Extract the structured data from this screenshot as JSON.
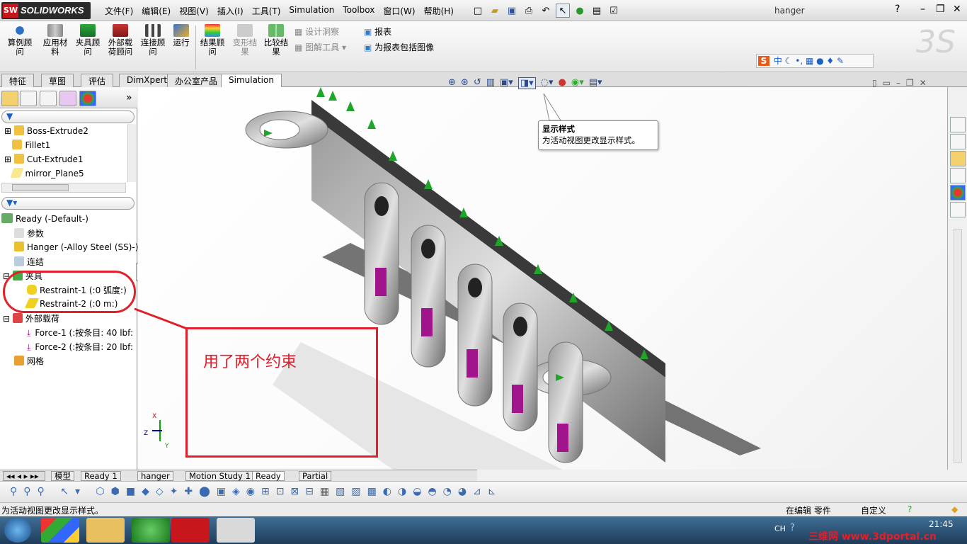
{
  "app": {
    "brand": "SOLIDWORKS",
    "brand_logo": "SW",
    "doc_title": "hanger"
  },
  "menu": [
    "文件(F)",
    "编辑(E)",
    "视图(V)",
    "插入(I)",
    "工具(T)",
    "Simulation",
    "Toolbox",
    "窗口(W)",
    "帮助(H)"
  ],
  "commands": [
    {
      "label": "算例顾\n问",
      "icon": "study-advisor-icon"
    },
    {
      "label": "应用材\n料",
      "icon": "apply-material-icon"
    },
    {
      "label": "夹具顾\n问",
      "icon": "fixtures-advisor-icon"
    },
    {
      "label": "外部载\n荷顾问",
      "icon": "external-loads-icon"
    },
    {
      "label": "连接顾\n问",
      "icon": "connections-icon"
    },
    {
      "label": "运行",
      "icon": "run-icon"
    },
    {
      "label": "结果顾\n问",
      "icon": "results-advisor-icon"
    },
    {
      "label": "变形结\n果",
      "icon": "deformed-result-icon"
    },
    {
      "label": "比较结\n果",
      "icon": "compare-results-icon"
    }
  ],
  "commands_small": [
    "设计洞察",
    "图解工具",
    "报表",
    "为报表包括图像"
  ],
  "ime": [
    "S",
    "中"
  ],
  "tabs": [
    "特征",
    "草图",
    "评估",
    "DimXpert",
    "办公室产品",
    "Simulation"
  ],
  "feature_tree": [
    "Boss-Extrude2",
    "Fillet1",
    "Cut-Extrude1",
    "mirror_Plane5"
  ],
  "sim_tree": {
    "root": "Ready (-Default-)",
    "params": "参数",
    "part": "Hanger (-Alloy Steel (SS)-)",
    "connections": "连结",
    "fixtures": "夹具",
    "restraint1": "Restraint-1 (:0 弧度:)",
    "restraint2": "Restraint-2 (:0 m:)",
    "loads": "外部载荷",
    "force1": "Force-1 (:按条目: 40 lbf:",
    "force2": "Force-2 (:按条目: 20 lbf:",
    "mesh": "网格"
  },
  "tooltip": {
    "title": "显示样式",
    "body": "为活动视图更改显示样式。"
  },
  "annotation": "用了两个约束",
  "triad": {
    "x": "X",
    "y": "Y",
    "z": "Z"
  },
  "bottom_tabs": [
    "模型",
    "Ready 1",
    "hanger",
    "Motion Study 1",
    "Ready",
    "Partial"
  ],
  "status": {
    "left": "为活动视图更改显示样式。",
    "edit": "在编辑 零件",
    "custom": "自定义"
  },
  "taskbar": {
    "lang": "CH",
    "time": "21:45",
    "watermark": "三维网 www.3dportal.cn"
  }
}
